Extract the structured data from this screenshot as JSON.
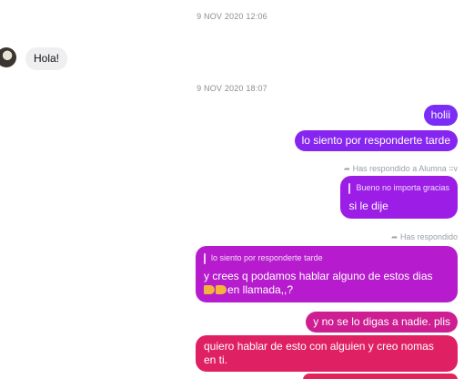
{
  "timestamps": [
    "9 NOV 2020 12:06",
    "9 NOV 2020 18:07"
  ],
  "incoming": {
    "text": "Hola!"
  },
  "messages": {
    "m1": "holii",
    "m2": "lo siento por responderte tarde",
    "reply1_meta": "Has respondido a Alumna =v",
    "reply1_quote": "Bueno no importa gracias",
    "reply1_text": "si le dije",
    "reply2_meta": "Has respondido",
    "reply2_quote": "lo siento por responderte tarde",
    "reply2_line1": "y crees q podamos hablar alguno de estos dias",
    "reply2_line2": "en llamada,,?",
    "m3": "y no se lo digas a nadie. plis",
    "m4_line1": "quiero hablar de esto con alguien y creo nomas",
    "m4_line2": "en ti."
  },
  "colors": {
    "accent_top": "#6b2bff",
    "accent_mid": "#b21fd0",
    "accent_bottom": "#e2245a"
  }
}
